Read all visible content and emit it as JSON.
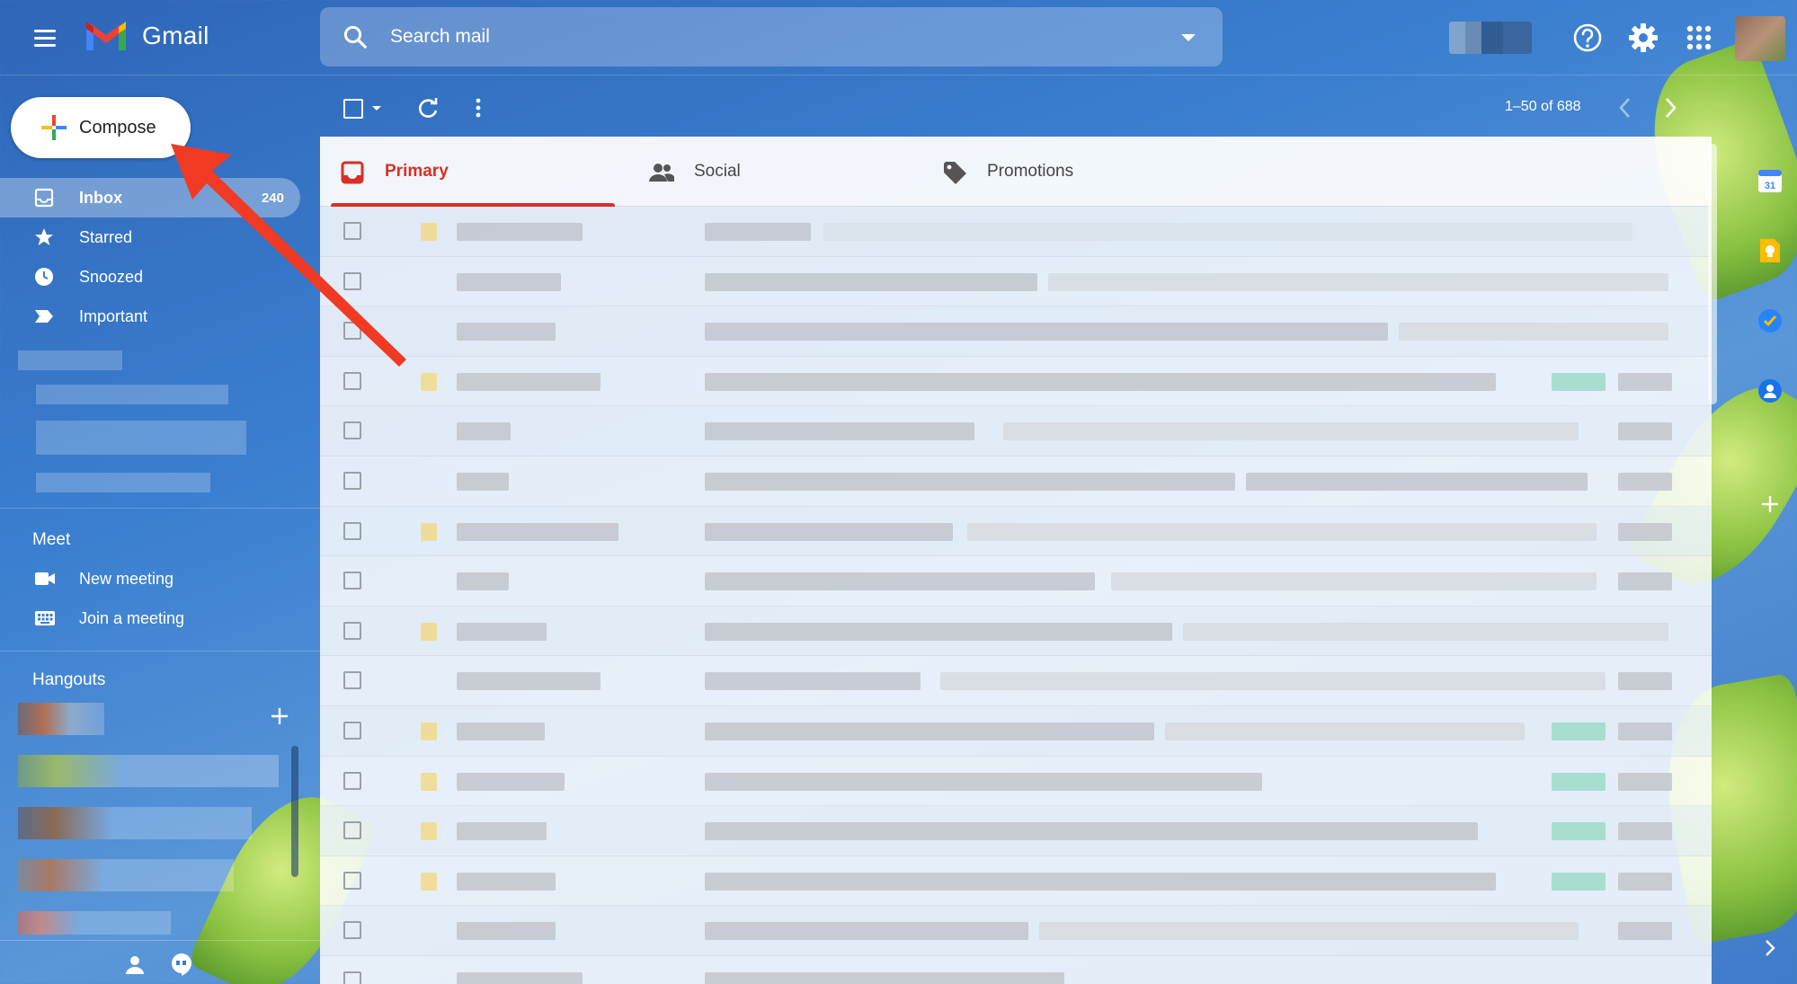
{
  "header": {
    "app_name": "Gmail",
    "search_placeholder": "Search mail"
  },
  "sidebar": {
    "compose_label": "Compose",
    "items": [
      {
        "label": "Inbox",
        "count": "240",
        "icon": "inbox-icon"
      },
      {
        "label": "Starred",
        "count": "",
        "icon": "star-icon"
      },
      {
        "label": "Snoozed",
        "count": "",
        "icon": "clock-icon"
      },
      {
        "label": "Important",
        "count": "",
        "icon": "important-icon"
      }
    ]
  },
  "meet": {
    "title": "Meet",
    "new_meeting": "New meeting",
    "join_meeting": "Join a meeting"
  },
  "hangouts": {
    "title": "Hangouts"
  },
  "toolbar": {
    "pagination": "1–50 of 688"
  },
  "tabs": [
    {
      "label": "Primary",
      "icon": "inbox-icon",
      "active": true
    },
    {
      "label": "Social",
      "icon": "people-icon",
      "active": false
    },
    {
      "label": "Promotions",
      "icon": "tag-icon",
      "active": false
    }
  ],
  "colors": {
    "accent_red": "#d93025",
    "annotation_arrow": "#f03a24"
  }
}
